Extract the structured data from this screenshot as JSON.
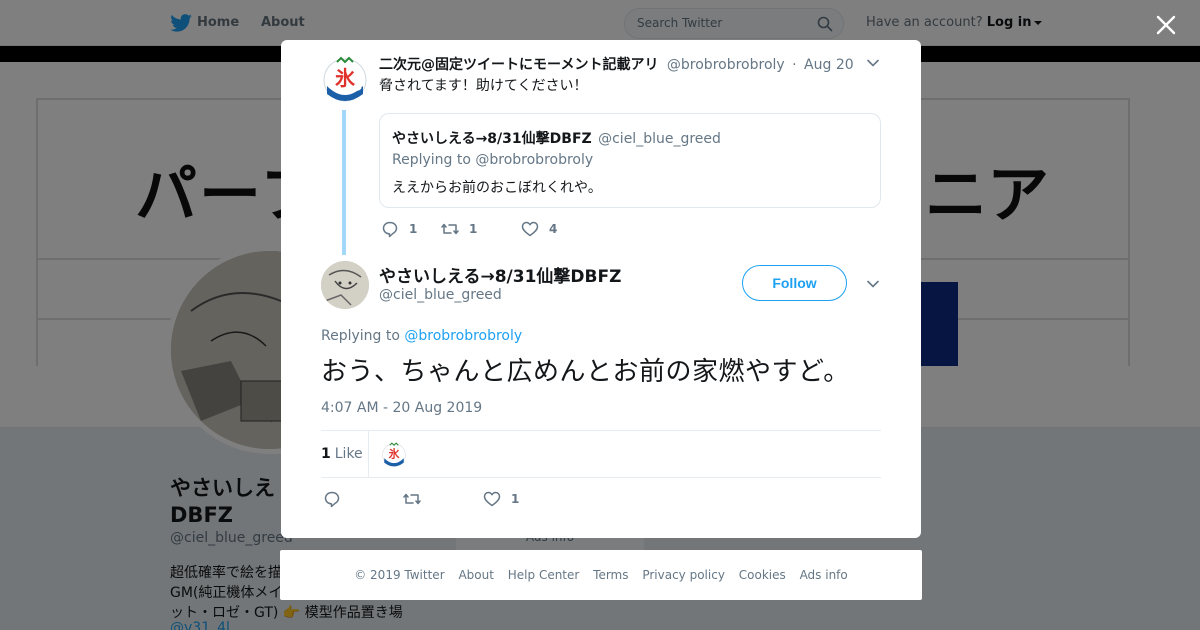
{
  "nav": {
    "home": "Home",
    "about": "About",
    "search_placeholder": "Search Twitter",
    "account_prompt": "Have an account?",
    "login": "Log in"
  },
  "background": {
    "banner_text_left": "パーフ",
    "banner_text_right": "ニア",
    "name_line1": "やさいしえ",
    "name_line2": "DBFZ",
    "handle": "@ciel_blue_greed",
    "bio_line1": "超低確率で絵を描",
    "bio_line2": "GM(純正機体メイ",
    "bio_line3": "ット・ロゼ・GT) 👉 模型作品置き場",
    "bio_line4": "@v31_4l",
    "ads_info": "Ads info"
  },
  "context_tweet": {
    "name": "二次元@固定ツイートにモーメント記載アリ",
    "handle": "@brobrobrobroly",
    "dot": "·",
    "time": "Aug 20",
    "text": "脅されてます！助けてください！",
    "quote": {
      "name": "やさいしえる→8/31仙撃DBFZ",
      "handle": "@ciel_blue_greed",
      "replying": "Replying to @brobrobrobroly",
      "text": "ええからお前のおこぼれくれや。"
    },
    "replies": "1",
    "retweets": "1",
    "likes": "4"
  },
  "main_tweet": {
    "name": "やさいしえる→8/31仙撃DBFZ",
    "handle": "@ciel_blue_greed",
    "follow": "Follow",
    "replying_label": "Replying to",
    "replying_handle": "@brobrobrobroly",
    "text": "おう、ちゃんと広めんとお前の家燃やすど。",
    "timestamp": "4:07 AM - 20 Aug 2019",
    "like_count": "1",
    "like_label": "Like",
    "action_likes": "1"
  },
  "footer": {
    "copyright": "© 2019 Twitter",
    "links": [
      "About",
      "Help Center",
      "Terms",
      "Privacy policy",
      "Cookies",
      "Ads info"
    ]
  },
  "colors": {
    "accent": "#1da1f2",
    "thread_line": "#a3d7f7",
    "muted_text": "#657786",
    "overlay": "rgba(0,0,0,0.5)"
  },
  "icons": [
    "twitter-bird-icon",
    "search-icon",
    "close-icon",
    "chevron-down-icon",
    "reply-icon",
    "retweet-icon",
    "like-icon"
  ]
}
